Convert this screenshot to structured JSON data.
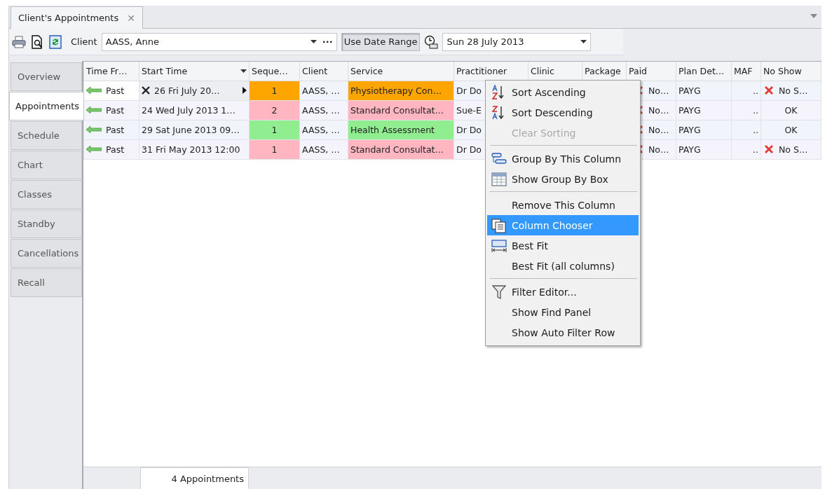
{
  "document_tabs": [
    {
      "label": "Client's Appointments",
      "selected": true,
      "close": "✕"
    }
  ],
  "toolbar": {
    "client_label": "Client",
    "client_value": "AASS, Anne",
    "ellipsis": "···",
    "date_range_button": {
      "label": "Use Date Range",
      "on": true
    },
    "date_value": "Sun 28 July 2013"
  },
  "side_tabs": [
    {
      "label": "Overview",
      "selected": false
    },
    {
      "label": "Appointments",
      "selected": true
    },
    {
      "label": "Schedule",
      "selected": false
    },
    {
      "label": "Chart",
      "selected": false
    },
    {
      "label": "Classes",
      "selected": false
    },
    {
      "label": "Standby",
      "selected": false
    },
    {
      "label": "Cancellations",
      "selected": false
    },
    {
      "label": "Recall",
      "selected": false
    }
  ],
  "table": {
    "columns": [
      {
        "label": "Time Fr…"
      },
      {
        "label": "Start Time",
        "dropdown": true
      },
      {
        "label": "Seque…"
      },
      {
        "label": "Client"
      },
      {
        "label": "Service"
      },
      {
        "label": "Practitioner"
      },
      {
        "label": "Clinic"
      },
      {
        "label": "Package"
      },
      {
        "label": "Paid"
      },
      {
        "label": "Plan Det…"
      },
      {
        "label": "MAF"
      },
      {
        "label": "No Show"
      }
    ],
    "rows": [
      {
        "focused": true,
        "color": "#ffa500",
        "time_frame": "Past",
        "start_time": "26 Fri July 20…",
        "sequence": "1",
        "client": "AASS, …",
        "service": "Physiotherapy Con…",
        "practitioner": "Dr Do",
        "paid": "No…",
        "plan": "PAYG",
        "maf": "..",
        "no_show": {
          "kind": "no_show",
          "text": "No S…"
        }
      },
      {
        "focused": false,
        "color": "#ffb6c1",
        "time_frame": "Past",
        "start_time": "24 Wed July 2013 1…",
        "sequence": "2",
        "client": "AASS, …",
        "service": "Standard Consultat…",
        "practitioner": "Sue-E",
        "paid": "No…",
        "plan": "PAYG",
        "maf": "..",
        "no_show": {
          "kind": "ok",
          "text": "OK"
        }
      },
      {
        "focused": false,
        "color": "#90ee90",
        "time_frame": "Past",
        "start_time": "29 Sat June 2013 09…",
        "sequence": "1",
        "client": "AASS, …",
        "service": "Health Assessment",
        "practitioner": "Dr Do",
        "paid": "No…",
        "plan": "PAYG",
        "maf": "..",
        "no_show": {
          "kind": "ok",
          "text": "OK"
        }
      },
      {
        "focused": false,
        "color": "#ffb6c1",
        "time_frame": "Past",
        "start_time": "31 Fri May 2013 12:00",
        "sequence": "1",
        "client": "AASS, …",
        "service": "Standard Consultat…",
        "practitioner": "Dr Do",
        "paid": "No…",
        "plan": "PAYG",
        "maf": "..",
        "no_show": {
          "kind": "no_show",
          "text": "No S…"
        }
      }
    ]
  },
  "context_menu": {
    "items": [
      {
        "kind": "item",
        "label": "Sort Ascending",
        "disabled": false,
        "selected": false
      },
      {
        "kind": "item",
        "label": "Sort Descending",
        "disabled": false,
        "selected": false
      },
      {
        "kind": "item",
        "label": "Clear Sorting",
        "disabled": true,
        "selected": false
      },
      {
        "kind": "separator"
      },
      {
        "kind": "item",
        "label": "Group By This Column",
        "disabled": false,
        "selected": false
      },
      {
        "kind": "item",
        "label": "Show Group By Box",
        "disabled": false,
        "selected": false
      },
      {
        "kind": "separator"
      },
      {
        "kind": "item",
        "label": "Remove This Column",
        "disabled": false,
        "selected": false
      },
      {
        "kind": "item",
        "label": "Column Chooser",
        "disabled": false,
        "selected": true
      },
      {
        "kind": "item",
        "label": "Best Fit",
        "disabled": false,
        "selected": false
      },
      {
        "kind": "item",
        "label": "Best Fit (all columns)",
        "disabled": false,
        "selected": false
      },
      {
        "kind": "separator"
      },
      {
        "kind": "item",
        "label": "Filter Editor...",
        "disabled": false,
        "selected": false
      },
      {
        "kind": "item",
        "label": "Show Find Panel",
        "disabled": false,
        "selected": false
      },
      {
        "kind": "item",
        "label": "Show Auto Filter Row",
        "disabled": false,
        "selected": false
      }
    ]
  },
  "footer": {
    "count": "4 Appointments"
  }
}
